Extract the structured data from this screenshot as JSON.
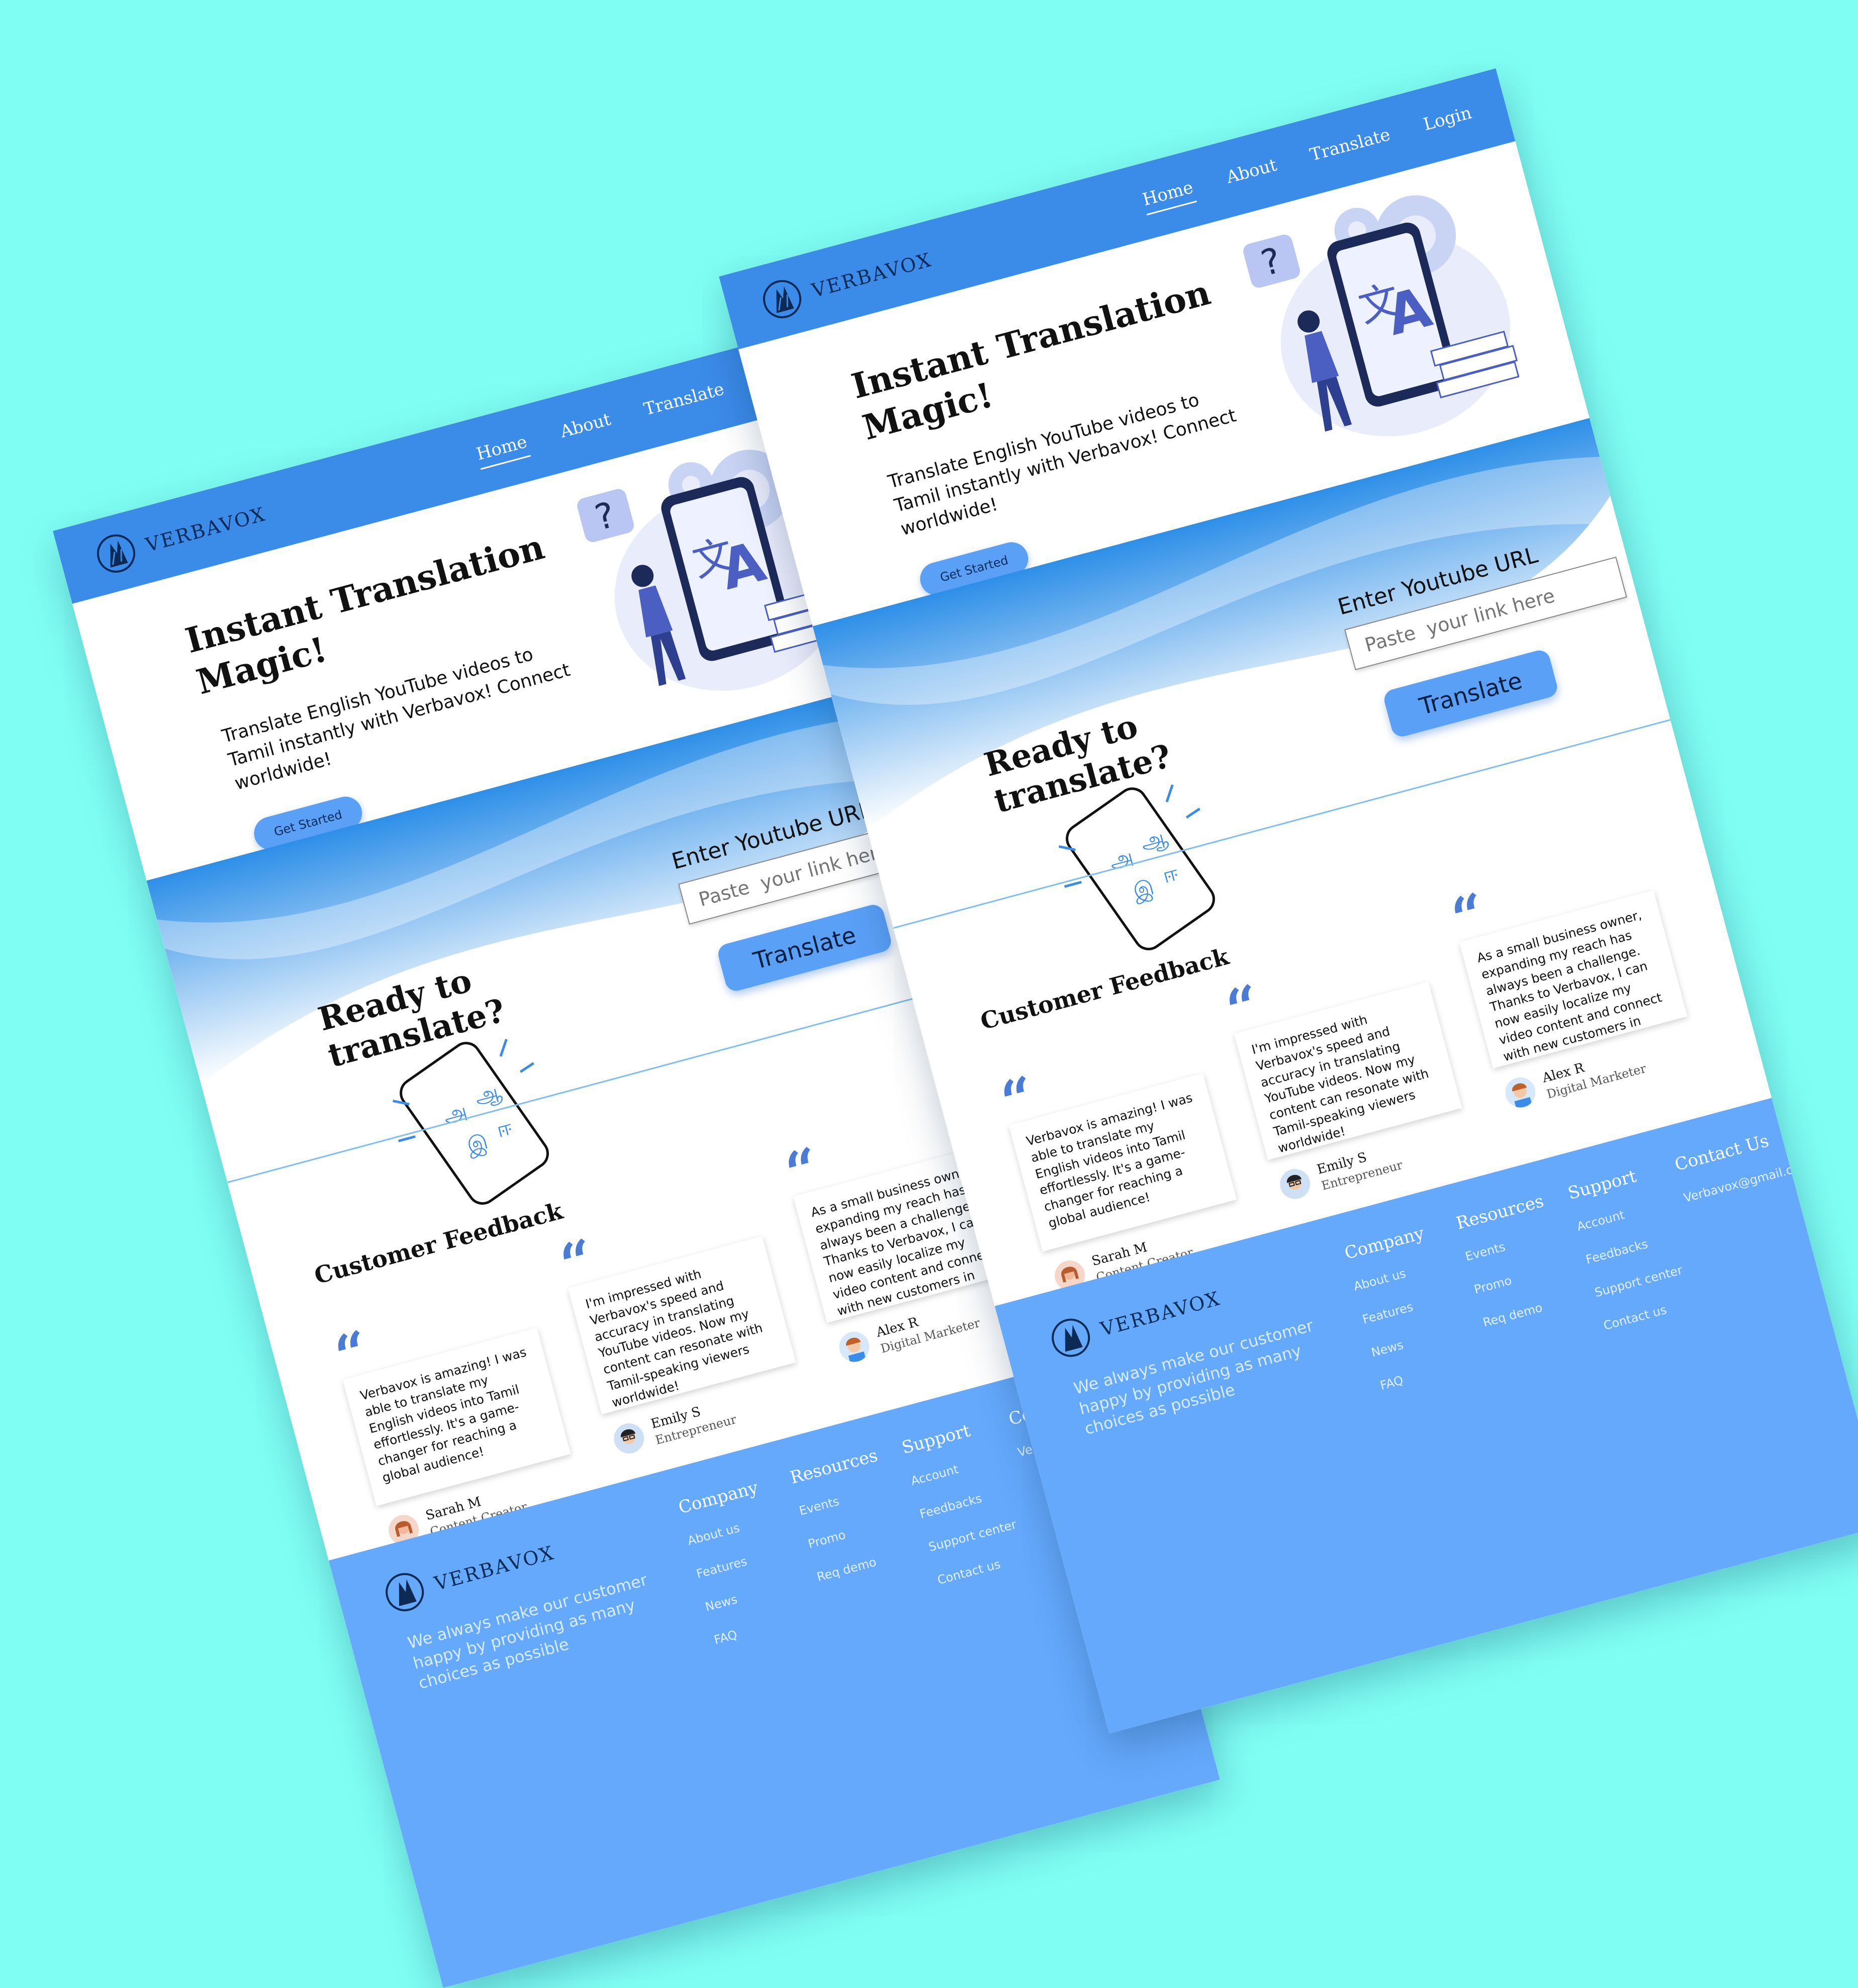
{
  "brand": {
    "name": "VERBAVOX"
  },
  "nav": {
    "home": "Home",
    "about": "About",
    "translate": "Translate",
    "login": "Login"
  },
  "hero": {
    "title": "Instant Translation Magic!",
    "subtitle": "Translate English YouTube videos to Tamil instantly with Verbavox! Connect worldwide!",
    "cta": "Get Started"
  },
  "translate": {
    "heading": "Ready to translate?",
    "label": "Enter Youtube URL",
    "placeholder": "Paste  your link here",
    "button": "Translate"
  },
  "feedback": {
    "title": "Customer Feedback",
    "quote_glyph": "“",
    "items": [
      {
        "text": "Verbavox is amazing! I was able to translate my English videos into Tamil effortlessly. It's a game-changer for reaching a global audience!",
        "name": "Sarah M",
        "role": "Content Creator",
        "avatar": "female-avatar"
      },
      {
        "text": "I'm impressed with Verbavox's speed and accuracy in translating YouTube videos. Now my content can resonate with Tamil-speaking viewers worldwide!",
        "name": "Emily S",
        "role": "Entrepreneur",
        "avatar": "male-avatar-glasses"
      },
      {
        "text": "As a small business owner, expanding my reach has always been a challenge. Thanks to Verbavox, I can now easily localize my video content and connect with new customers in",
        "name": "Alex R",
        "role": "Digital Marketer",
        "avatar": "male-avatar"
      }
    ]
  },
  "footer": {
    "tagline": "We always make our customer happy by providing as many choices as possible",
    "columns": [
      {
        "title": "Company",
        "links": [
          "About us",
          "Features",
          "News",
          "FAQ"
        ]
      },
      {
        "title": "Resources",
        "links": [
          "Events",
          "Promo",
          "Req demo"
        ]
      },
      {
        "title": "Support",
        "links": [
          "Account",
          "Feedbacks",
          "Support center",
          "Contact us"
        ]
      },
      {
        "title": "Contact Us",
        "links": [
          "Verbavox@gmail.com"
        ]
      }
    ]
  },
  "colors": {
    "background": "#7ffff4",
    "header": "#3b8be9",
    "accent": "#5aa0f7",
    "footer": "#64a9fb",
    "quote": "#4a7bd6"
  }
}
